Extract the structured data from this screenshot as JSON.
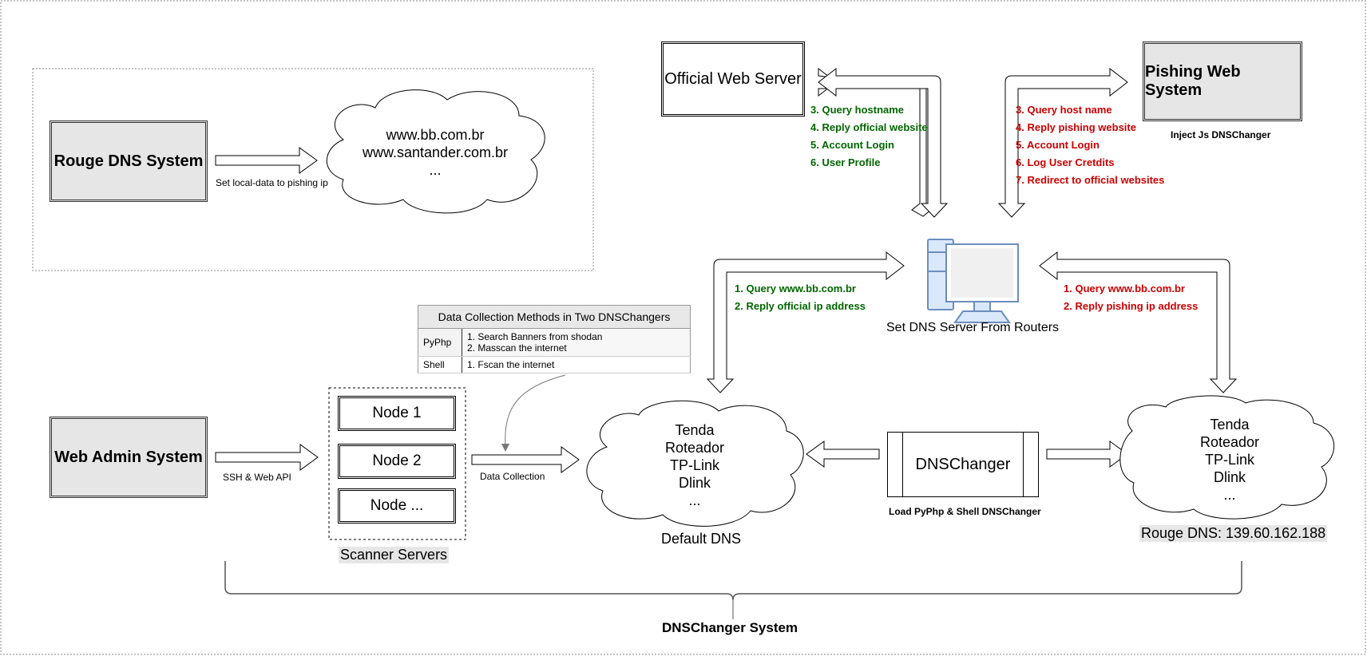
{
  "top_left_group": {
    "rouge_dns_system": "Rouge DNS System",
    "arrow_label": "Set local-data to pishing ip",
    "domains_cloud": [
      "www.bb.com.br",
      "www.santander.com.br",
      "..."
    ]
  },
  "official_web_server": {
    "label": "Official Web Server",
    "steps": [
      "3. Query hostname",
      "4. Reply official website",
      "5. Account Login",
      "6. User Profile"
    ]
  },
  "pishing_web_system": {
    "label": "Pishing Web System",
    "caption": "Inject Js DNSChanger",
    "steps": [
      "3. Query host name",
      "4. Reply pishing website",
      "5. Account Login",
      "6. Log User Cretdits",
      "7. Redirect to official websites"
    ]
  },
  "client": {
    "icon": "computer-icon",
    "caption": "Set DNS Server From Routers",
    "left_steps": [
      "1. Query www.bb.com.br",
      "2. Reply official ip address"
    ],
    "right_steps": [
      "1. Query www.bb.com.br",
      "2. Reply pishing ip address"
    ]
  },
  "data_collection_table": {
    "title": "Data Collection Methods in Two DNSChangers",
    "rows": [
      {
        "key": "PyPhp",
        "values": [
          "1. Search Banners from shodan",
          "2. Masscan the internet"
        ]
      },
      {
        "key": "Shell",
        "values": [
          "1. Fscan the internet"
        ]
      }
    ]
  },
  "web_admin": {
    "label": "Web Admin System",
    "arrow_label": "SSH & Web API"
  },
  "scanner_servers": {
    "nodes": [
      "Node 1",
      "Node 2",
      "Node ..."
    ],
    "caption": "Scanner Servers",
    "arrow_label": "Data Collection"
  },
  "default_dns": {
    "routers": [
      "Tenda",
      "Roteador",
      "TP-Link",
      "Dlink",
      "..."
    ],
    "caption": "Default DNS"
  },
  "dnschanger": {
    "label": "DNSChanger",
    "caption": "Load PyPhp & Shell DNSChanger"
  },
  "rouge_dns": {
    "routers": [
      "Tenda",
      "Roteador",
      "TP-Link",
      "Dlink",
      "..."
    ],
    "caption": "Rouge DNS: 139.60.162.188"
  },
  "system_brace_label": "DNSChanger System",
  "colors": {
    "official_steps": "#006600",
    "pishing_steps": "#cc0000",
    "computer_blue": "#6c8ebf",
    "box_fill": "#e6e6e6"
  }
}
